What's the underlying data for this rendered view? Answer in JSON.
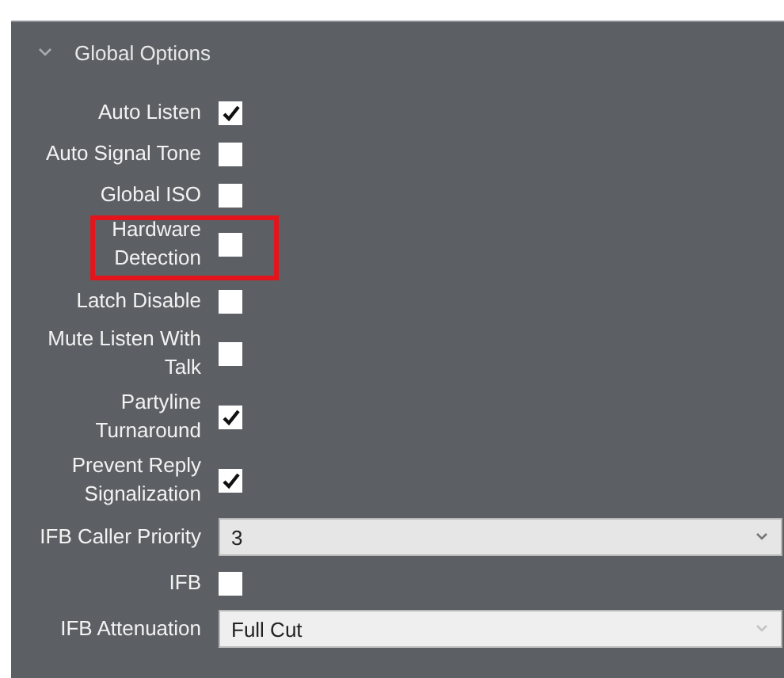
{
  "section": {
    "title": "Global Options",
    "expanded": true
  },
  "options": [
    {
      "kind": "checkbox",
      "label": "Auto Listen",
      "checked": true,
      "highlighted": false
    },
    {
      "kind": "checkbox",
      "label": "Auto Signal Tone",
      "checked": false,
      "highlighted": false
    },
    {
      "kind": "checkbox",
      "label": "Global ISO",
      "checked": false,
      "highlighted": false
    },
    {
      "kind": "checkbox",
      "label": "Hardware Detection",
      "checked": false,
      "highlighted": true
    },
    {
      "kind": "checkbox",
      "label": "Latch Disable",
      "checked": false,
      "highlighted": false
    },
    {
      "kind": "checkbox",
      "label": "Mute Listen With Talk",
      "checked": false,
      "highlighted": false
    },
    {
      "kind": "checkbox",
      "label": "Partyline Turnaround",
      "checked": true,
      "highlighted": false
    },
    {
      "kind": "checkbox",
      "label": "Prevent Reply Signalization",
      "checked": true,
      "highlighted": false
    },
    {
      "kind": "dropdown",
      "label": "IFB Caller Priority",
      "value": "3",
      "disabled": false
    },
    {
      "kind": "checkbox",
      "label": "IFB",
      "checked": false,
      "highlighted": false
    },
    {
      "kind": "dropdown",
      "label": "IFB Attenuation",
      "value": "Full Cut",
      "disabled": true
    }
  ]
}
